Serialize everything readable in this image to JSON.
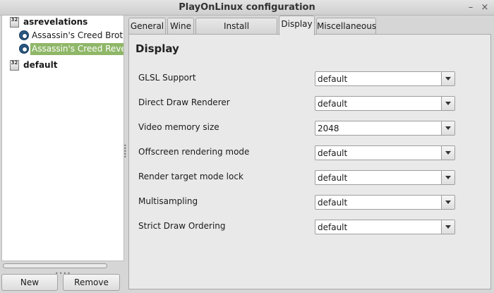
{
  "window": {
    "title": "PlayOnLinux configuration",
    "minimize_glyph": "–",
    "close_glyph": "×"
  },
  "sidebar": {
    "prefixes": [
      {
        "name": "asrevelations",
        "icon": "prefix-32bit-icon",
        "badge": "32",
        "items": [
          {
            "label": "Assassin's Creed Brotherhood",
            "icon": "steam-icon",
            "selected": false
          },
          {
            "label": "Assassin's Creed Revelations",
            "icon": "steam-icon",
            "selected": true
          }
        ]
      },
      {
        "name": "default",
        "icon": "prefix-32bit-icon",
        "badge": "32",
        "items": []
      }
    ],
    "new_label": "New",
    "remove_label": "Remove"
  },
  "tabs": [
    "General",
    "Wine",
    "Install components",
    "Display",
    "Miscellaneous"
  ],
  "active_tab": "Display",
  "display": {
    "heading": "Display",
    "settings": [
      {
        "label": "GLSL Support",
        "value": "default"
      },
      {
        "label": "Direct Draw Renderer",
        "value": "default"
      },
      {
        "label": "Video memory size",
        "value": "2048"
      },
      {
        "label": "Offscreen rendering mode",
        "value": "default"
      },
      {
        "label": "Render target mode lock",
        "value": "default"
      },
      {
        "label": "Multisampling",
        "value": "default"
      },
      {
        "label": "Strict Draw Ordering",
        "value": "default"
      }
    ]
  },
  "colors": {
    "selection": "#8fb768"
  }
}
